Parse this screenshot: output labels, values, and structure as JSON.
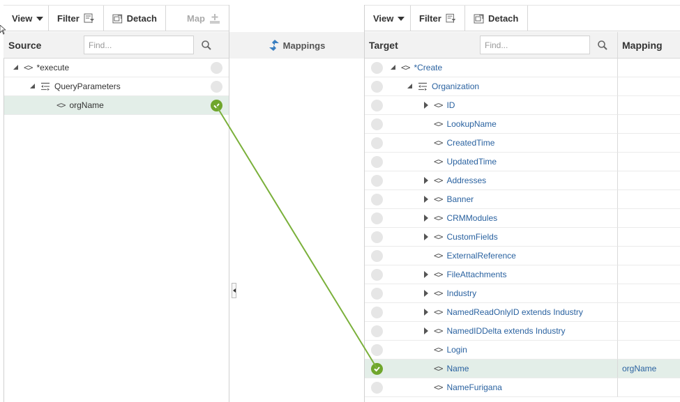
{
  "source_toolbar": {
    "view": "View",
    "filter": "Filter",
    "detach": "Detach",
    "map": "Map"
  },
  "target_toolbar": {
    "view": "View",
    "filter": "Filter",
    "detach": "Detach"
  },
  "source_header": {
    "title": "Source",
    "find_placeholder": "Find..."
  },
  "target_header": {
    "title": "Target",
    "find_placeholder": "Find...",
    "mapping_column": "Mapping"
  },
  "mappings_label": "Mappings",
  "source_tree": [
    {
      "label": "*execute",
      "kind": "element",
      "depth": 0,
      "expander": "open",
      "mapped": false
    },
    {
      "label": "QueryParameters",
      "kind": "group",
      "depth": 1,
      "expander": "open",
      "mapped": false
    },
    {
      "label": "orgName",
      "kind": "element",
      "depth": 2,
      "expander": "none",
      "mapped": true
    }
  ],
  "target_tree": [
    {
      "label": "*Create",
      "kind": "element",
      "depth": 0,
      "expander": "open",
      "mapped": false,
      "mapping": ""
    },
    {
      "label": "Organization",
      "kind": "group",
      "depth": 1,
      "expander": "open",
      "mapped": false,
      "mapping": ""
    },
    {
      "label": "ID",
      "kind": "element",
      "depth": 2,
      "expander": "closed",
      "mapped": false,
      "mapping": ""
    },
    {
      "label": "LookupName",
      "kind": "element",
      "depth": 2,
      "expander": "none",
      "mapped": false,
      "mapping": ""
    },
    {
      "label": "CreatedTime",
      "kind": "element",
      "depth": 2,
      "expander": "none",
      "mapped": false,
      "mapping": ""
    },
    {
      "label": "UpdatedTime",
      "kind": "element",
      "depth": 2,
      "expander": "none",
      "mapped": false,
      "mapping": ""
    },
    {
      "label": "Addresses",
      "kind": "element",
      "depth": 2,
      "expander": "closed",
      "mapped": false,
      "mapping": ""
    },
    {
      "label": "Banner",
      "kind": "element",
      "depth": 2,
      "expander": "closed",
      "mapped": false,
      "mapping": ""
    },
    {
      "label": "CRMModules",
      "kind": "element",
      "depth": 2,
      "expander": "closed",
      "mapped": false,
      "mapping": ""
    },
    {
      "label": "CustomFields",
      "kind": "element",
      "depth": 2,
      "expander": "closed",
      "mapped": false,
      "mapping": ""
    },
    {
      "label": "ExternalReference",
      "kind": "element",
      "depth": 2,
      "expander": "none",
      "mapped": false,
      "mapping": ""
    },
    {
      "label": "FileAttachments",
      "kind": "element",
      "depth": 2,
      "expander": "closed",
      "mapped": false,
      "mapping": ""
    },
    {
      "label": "Industry",
      "kind": "element",
      "depth": 2,
      "expander": "closed",
      "mapped": false,
      "mapping": ""
    },
    {
      "label": "NamedReadOnlyID extends Industry",
      "kind": "element",
      "depth": 2,
      "expander": "closed",
      "mapped": false,
      "mapping": ""
    },
    {
      "label": "NamedIDDelta extends Industry",
      "kind": "element",
      "depth": 2,
      "expander": "closed",
      "mapped": false,
      "mapping": ""
    },
    {
      "label": "Login",
      "kind": "element",
      "depth": 2,
      "expander": "none",
      "mapped": false,
      "mapping": ""
    },
    {
      "label": "Name",
      "kind": "element",
      "depth": 2,
      "expander": "none",
      "mapped": true,
      "mapping": "orgName"
    },
    {
      "label": "NameFurigana",
      "kind": "element",
      "depth": 2,
      "expander": "none",
      "mapped": false,
      "mapping": ""
    }
  ],
  "colors": {
    "mapped_green": "#6fa62c",
    "link_blue": "#2a62a0",
    "selected_row": "#e3eee8"
  }
}
